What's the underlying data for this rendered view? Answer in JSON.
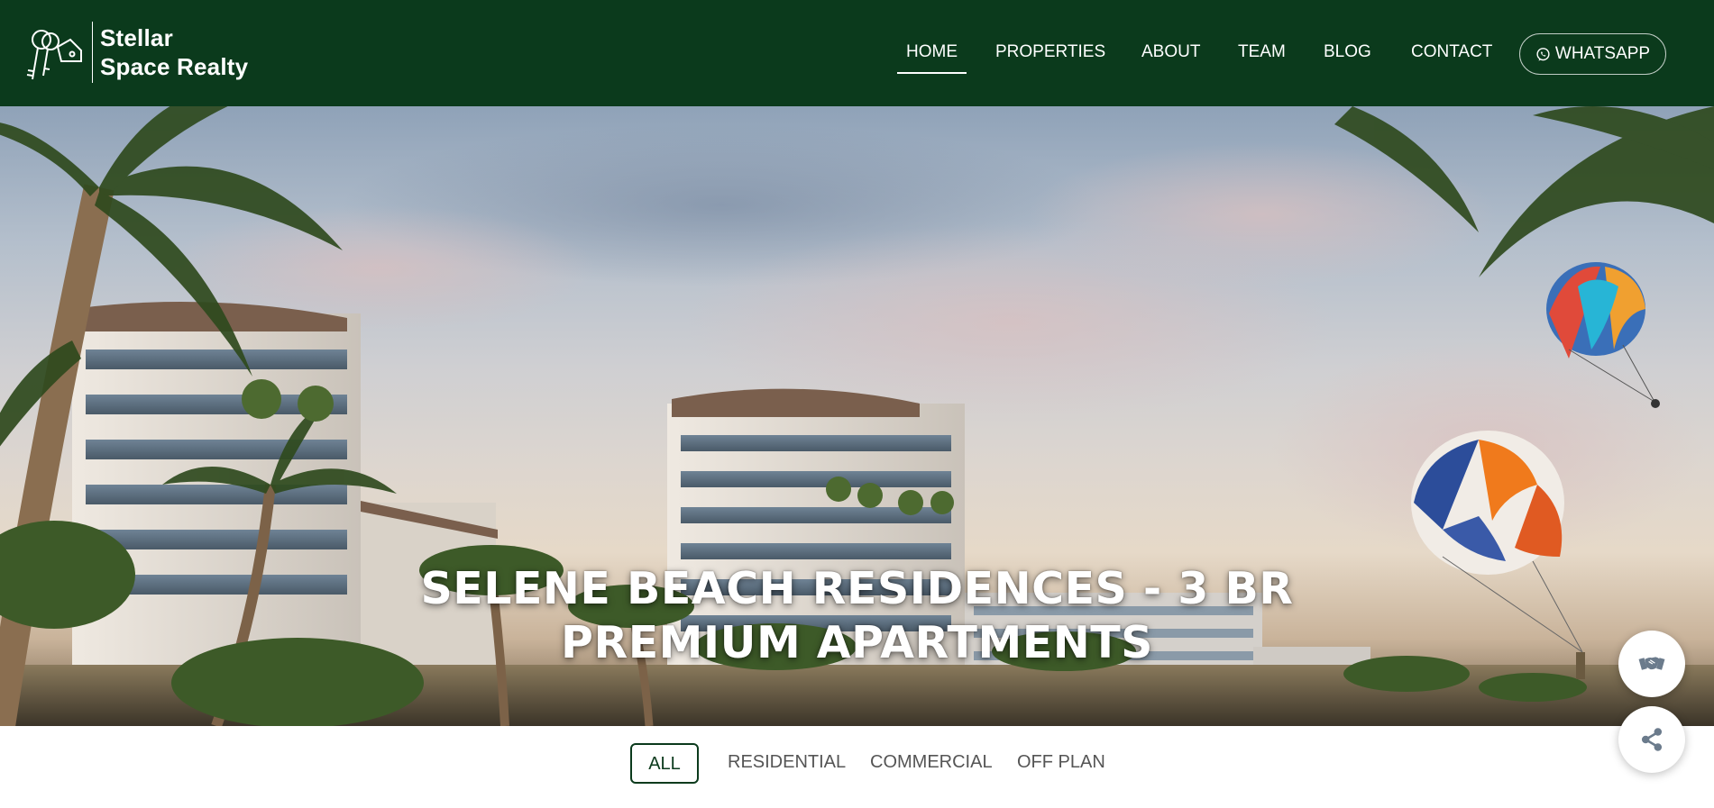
{
  "brand": {
    "name": "Stellar\nSpace Realty",
    "logo_icon": "keys-house-logo"
  },
  "nav": {
    "items": [
      {
        "label": "HOME",
        "active": true
      },
      {
        "label": "PROPERTIES",
        "active": false
      },
      {
        "label": "ABOUT",
        "active": false
      },
      {
        "label": "TEAM",
        "active": false
      },
      {
        "label": "BLOG",
        "active": false
      },
      {
        "label": "CONTACT",
        "active": false
      }
    ],
    "whatsapp": {
      "label": "WHATSAPP",
      "icon": "whatsapp-icon"
    }
  },
  "hero": {
    "title": "SELENE BEACH RESIDENCES - 3 BR PREMIUM APARTMENTS"
  },
  "filters": {
    "tabs": [
      {
        "label": "ALL",
        "active": true
      },
      {
        "label": "RESIDENTIAL",
        "active": false
      },
      {
        "label": "COMMERCIAL",
        "active": false
      },
      {
        "label": "OFF PLAN",
        "active": false
      }
    ]
  },
  "floating": {
    "handshake_icon": "handshake-icon",
    "share_icon": "share-icon"
  },
  "colors": {
    "header_bg": "#0b3a1c",
    "accent": "#0b3a1c",
    "text_light": "#ffffff",
    "tab_text": "#555555"
  }
}
